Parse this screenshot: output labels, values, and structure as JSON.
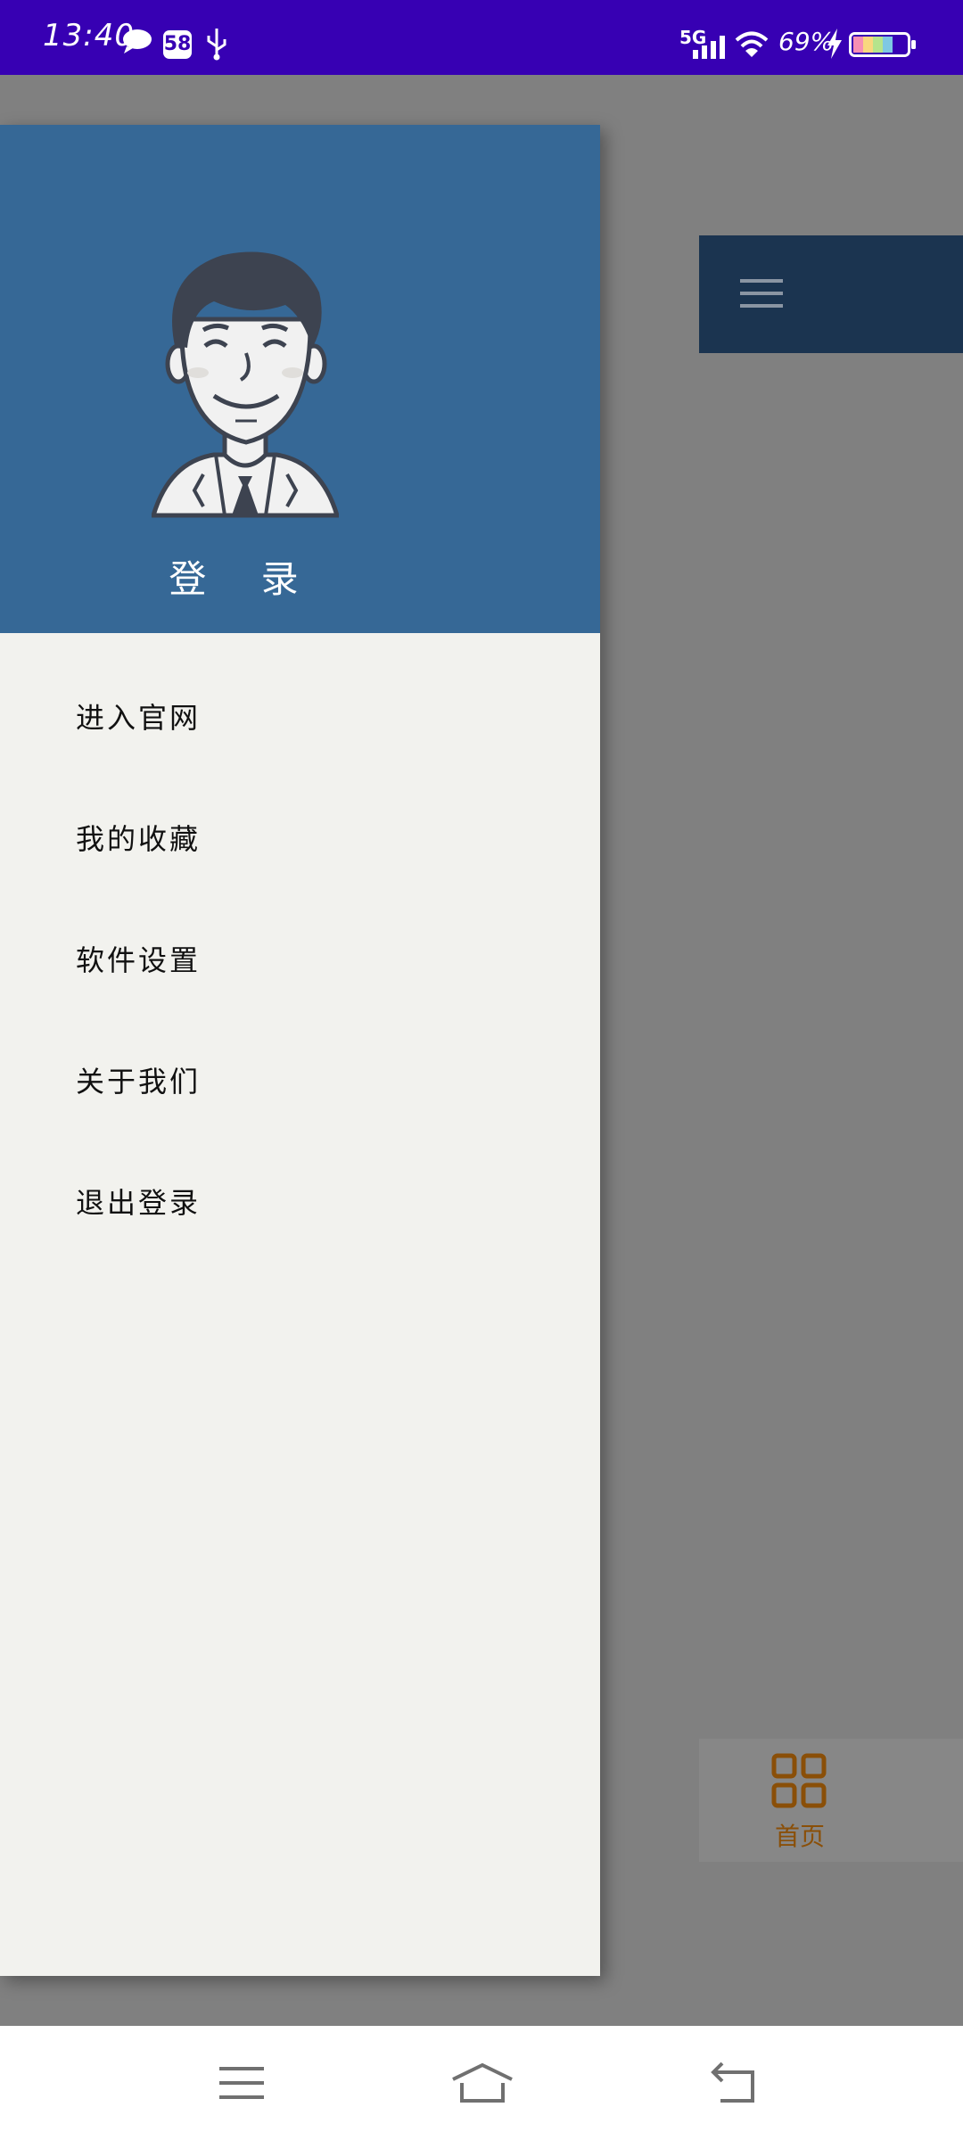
{
  "status_bar": {
    "time": "13:40",
    "notification_count": "58",
    "network": "5G",
    "battery_percent": "69%",
    "icons": [
      "chat-bubble-icon",
      "usb-icon",
      "signal-icon",
      "wifi-icon",
      "charging-bolt-icon",
      "battery-icon"
    ]
  },
  "drawer": {
    "header": {
      "login_label": "登 录",
      "avatar": "avatar"
    },
    "menu_items": [
      {
        "label": "进入官网"
      },
      {
        "label": "我的收藏"
      },
      {
        "label": "软件设置"
      },
      {
        "label": "关于我们"
      },
      {
        "label": "退出登录"
      }
    ]
  },
  "background_app": {
    "toolbar_icon": "hamburger-menu-icon",
    "bottom_tab": {
      "label": "首页",
      "icon": "grid-icon"
    }
  },
  "nav_bar": {
    "buttons": [
      "menu",
      "home",
      "back"
    ]
  },
  "colors": {
    "status_bar": "#3700b3",
    "drawer_header": "#366896",
    "drawer_body": "#f2f2ee",
    "scrim": "#808080",
    "toolbar": "#1b3450",
    "tab_accent": "#8a4f08"
  }
}
